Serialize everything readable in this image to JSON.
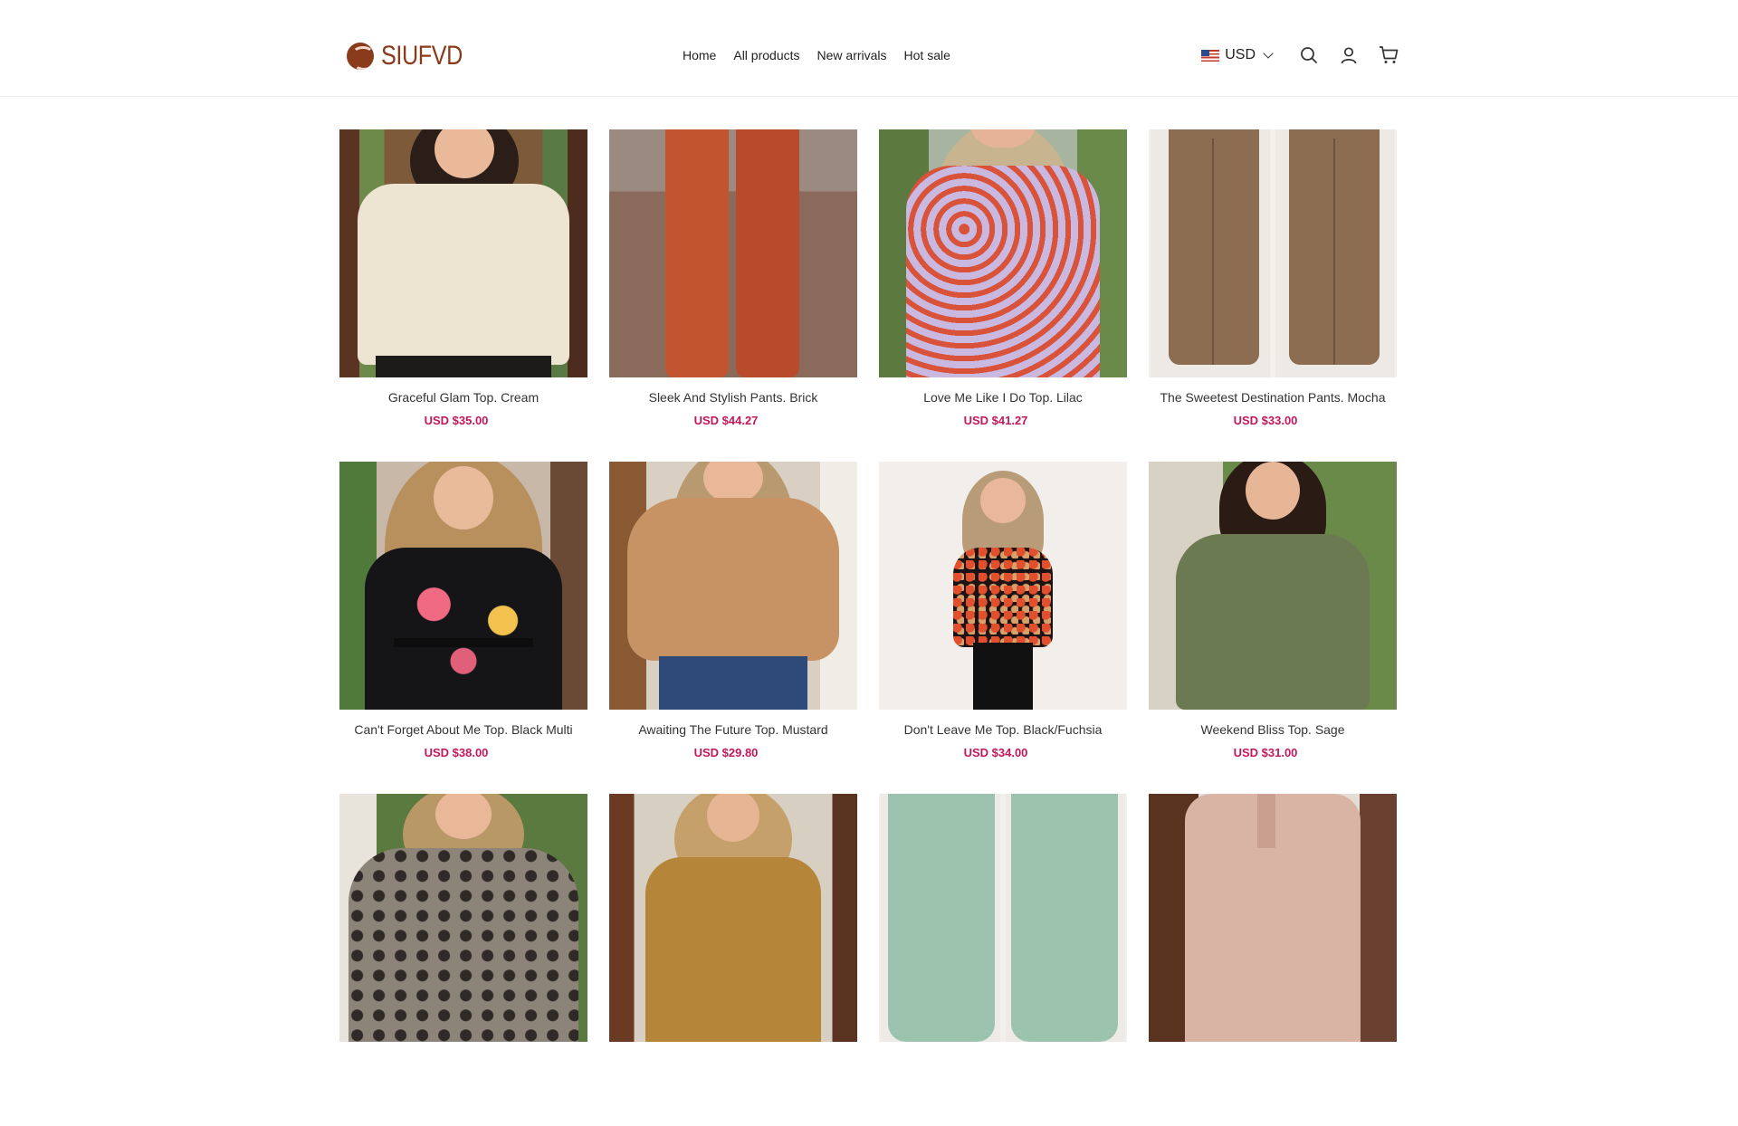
{
  "brand": {
    "name": "SIUFVD"
  },
  "nav": [
    "Home",
    "All products",
    "New arrivals",
    "Hot sale"
  ],
  "currency": {
    "code": "USD"
  },
  "products": [
    {
      "title": "Graceful Glam Top. Cream",
      "price": "USD $35.00"
    },
    {
      "title": "Sleek And Stylish Pants. Brick",
      "price": "USD $44.27"
    },
    {
      "title": "Love Me Like I Do Top. Lilac",
      "price": "USD $41.27"
    },
    {
      "title": "The Sweetest Destination Pants. Mocha",
      "price": "USD $33.00"
    },
    {
      "title": "Can't Forget About Me Top. Black Multi",
      "price": "USD $38.00"
    },
    {
      "title": "Awaiting The Future Top. Mustard",
      "price": "USD $29.80"
    },
    {
      "title": "Don't Leave Me Top. Black/Fuchsia",
      "price": "USD $34.00"
    },
    {
      "title": "Weekend Bliss Top. Sage",
      "price": "USD $31.00"
    },
    {
      "title": "",
      "price": ""
    },
    {
      "title": "",
      "price": ""
    },
    {
      "title": "",
      "price": ""
    },
    {
      "title": "",
      "price": ""
    }
  ],
  "colors": {
    "accent": "#c2185b",
    "brand": "#8a3b1c"
  }
}
